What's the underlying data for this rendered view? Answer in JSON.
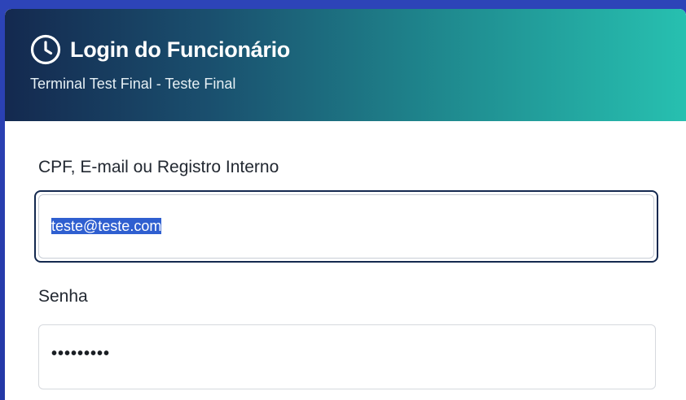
{
  "header": {
    "title": "Login do Funcionário",
    "subtitle": "Terminal Test Final - Teste Final",
    "icon": "clock-icon",
    "gradient_colors": [
      "#14294f",
      "#27c0b0"
    ]
  },
  "form": {
    "login_label": "CPF, E-mail ou Registro Interno",
    "login_value": "teste@teste.com",
    "password_label": "Senha",
    "password_masked": "•••••••••"
  },
  "colors": {
    "background": "#2a3fae",
    "selection": "#2f5fd0",
    "focus_ring": "#14294f"
  }
}
